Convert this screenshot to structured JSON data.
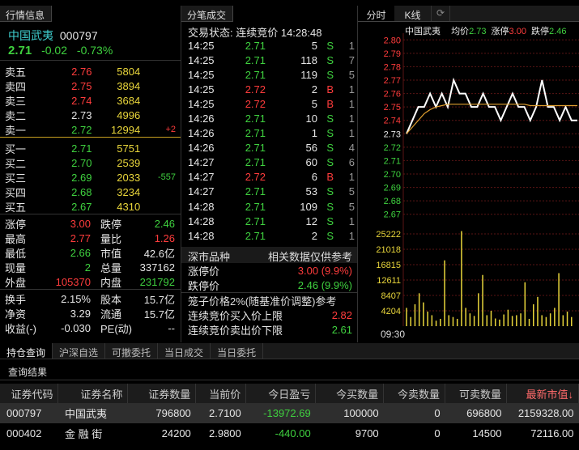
{
  "quote_panel": {
    "tab": "行情信息",
    "name": "中国武夷",
    "code": "000797",
    "price": "2.71",
    "change": "-0.02",
    "change_pct": "-0.73%",
    "asks": [
      {
        "label": "卖五",
        "price": "2.76",
        "vol": "5804",
        "diff": ""
      },
      {
        "label": "卖四",
        "price": "2.75",
        "vol": "3894",
        "diff": ""
      },
      {
        "label": "卖三",
        "price": "2.74",
        "vol": "3684",
        "diff": ""
      },
      {
        "label": "卖二",
        "price": "2.73",
        "vol": "4996",
        "diff": ""
      },
      {
        "label": "卖一",
        "price": "2.72",
        "vol": "12994",
        "diff": "+2"
      }
    ],
    "bids": [
      {
        "label": "买一",
        "price": "2.71",
        "vol": "5751",
        "diff": ""
      },
      {
        "label": "买二",
        "price": "2.70",
        "vol": "2539",
        "diff": ""
      },
      {
        "label": "买三",
        "price": "2.69",
        "vol": "2033",
        "diff": "-557"
      },
      {
        "label": "买四",
        "price": "2.68",
        "vol": "3234",
        "diff": ""
      },
      {
        "label": "买五",
        "price": "2.67",
        "vol": "4310",
        "diff": ""
      }
    ],
    "stats": [
      [
        "涨停",
        "3.00",
        "跌停",
        "2.46"
      ],
      [
        "最高",
        "2.77",
        "量比",
        "1.26"
      ],
      [
        "最低",
        "2.66",
        "市值",
        "42.6亿"
      ],
      [
        "现量",
        "2",
        "总量",
        "337162"
      ],
      [
        "外盘",
        "105370",
        "内盘",
        "231792"
      ]
    ],
    "stats2": [
      [
        "换手",
        "2.15%",
        "股本",
        "15.7亿"
      ],
      [
        "净资",
        "3.29",
        "流通",
        "15.7亿"
      ],
      [
        "收益(-)",
        "-0.030",
        "PE(动)",
        "--"
      ]
    ]
  },
  "trades_panel": {
    "tab": "分笔成交",
    "status": "交易状态: 连续竞价 14:28:48",
    "rows": [
      [
        "14:25",
        "2.71",
        "5",
        "S",
        "1"
      ],
      [
        "14:25",
        "2.71",
        "118",
        "S",
        "7"
      ],
      [
        "14:25",
        "2.71",
        "119",
        "S",
        "5"
      ],
      [
        "14:25",
        "2.72",
        "2",
        "B",
        "1"
      ],
      [
        "14:25",
        "2.72",
        "5",
        "B",
        "1"
      ],
      [
        "14:26",
        "2.71",
        "10",
        "S",
        "1"
      ],
      [
        "14:26",
        "2.71",
        "1",
        "S",
        "1"
      ],
      [
        "14:26",
        "2.71",
        "56",
        "S",
        "4"
      ],
      [
        "14:27",
        "2.71",
        "60",
        "S",
        "6"
      ],
      [
        "14:27",
        "2.72",
        "6",
        "B",
        "1"
      ],
      [
        "14:27",
        "2.71",
        "53",
        "S",
        "5"
      ],
      [
        "14:28",
        "2.71",
        "109",
        "S",
        "5"
      ],
      [
        "14:28",
        "2.71",
        "12",
        "S",
        "1"
      ],
      [
        "14:28",
        "2.71",
        "2",
        "S",
        "1"
      ]
    ],
    "board_label": "深市品种",
    "board_note": "相关数据仅供参考",
    "limits": [
      [
        "涨停价",
        "3.00 (9.9%)"
      ],
      [
        "跌停价",
        "2.46 (9.9%)"
      ]
    ],
    "cage": "笼子价格2%(随基准价调整)参考",
    "cage_rows": [
      [
        "连续竞价买入价上限",
        "2.82"
      ],
      [
        "连续竞价卖出价下限",
        "2.61"
      ]
    ]
  },
  "chart_panel": {
    "tabs": [
      "分时",
      "K线"
    ],
    "title": "中国武夷",
    "avg_label": "均价",
    "avg": "2.73",
    "up_label": "涨停",
    "up": "3.00",
    "down_label": "跌停",
    "down": "2.46",
    "price_ticks": [
      "2.80",
      "2.79",
      "2.78",
      "2.77",
      "2.76",
      "2.75",
      "2.74",
      "2.73",
      "2.72",
      "2.71",
      "2.70",
      "2.69",
      "2.68",
      "2.67"
    ],
    "vol_ticks": [
      "25222",
      "21018",
      "16815",
      "12611",
      "8407",
      "4204"
    ],
    "time_label": "09:30"
  },
  "chart_data": {
    "type": "line",
    "title": "中国武夷",
    "ylim": [
      2.665,
      2.805
    ],
    "series": [
      {
        "name": "价格",
        "values": [
          2.73,
          2.74,
          2.75,
          2.75,
          2.76,
          2.75,
          2.76,
          2.75,
          2.77,
          2.76,
          2.76,
          2.75,
          2.75,
          2.76,
          2.75,
          2.75,
          2.74,
          2.75,
          2.76,
          2.75,
          2.75,
          2.74,
          2.75,
          2.77,
          2.75,
          2.75,
          2.74,
          2.75,
          2.74,
          2.74
        ]
      },
      {
        "name": "均价",
        "values": [
          2.73,
          2.735,
          2.74,
          2.745,
          2.748,
          2.75,
          2.751,
          2.752,
          2.752,
          2.752,
          2.752,
          2.752,
          2.752,
          2.752,
          2.752,
          2.752,
          2.752,
          2.752,
          2.752,
          2.752,
          2.752,
          2.751,
          2.751,
          2.751,
          2.751,
          2.751,
          2.751,
          2.751,
          2.751,
          2.751
        ]
      }
    ],
    "volume": [
      5000,
      2500,
      6000,
      9000,
      6500,
      4000,
      3000,
      1500,
      2000,
      18000,
      3000,
      2500,
      2000,
      26000,
      5000,
      3500,
      2800,
      9000,
      14000,
      3000,
      4200,
      2100,
      1800,
      3200,
      4500,
      2800,
      3000,
      3500,
      12000,
      2000,
      6000,
      8000,
      3000,
      2500,
      3500,
      5000,
      14500,
      3000,
      4000,
      2500
    ]
  },
  "bottom": {
    "tabs": [
      "持仓查询",
      "沪深自选",
      "可撤委托",
      "当日成交",
      "当日委托"
    ],
    "result_label": "查询结果",
    "columns": [
      "证券代码",
      "证券名称",
      "证券数量",
      "当前价",
      "今日盈亏",
      "今买数量",
      "今卖数量",
      "可卖数量",
      "最新市值↓"
    ],
    "rows": [
      [
        "000797",
        "中国武夷",
        "796800",
        "2.7100",
        "-13972.69",
        "100000",
        "0",
        "696800",
        "2159328.00"
      ],
      [
        "000402",
        "金 融 街",
        "24200",
        "2.9800",
        "-440.00",
        "9700",
        "0",
        "14500",
        "72116.00"
      ]
    ]
  }
}
